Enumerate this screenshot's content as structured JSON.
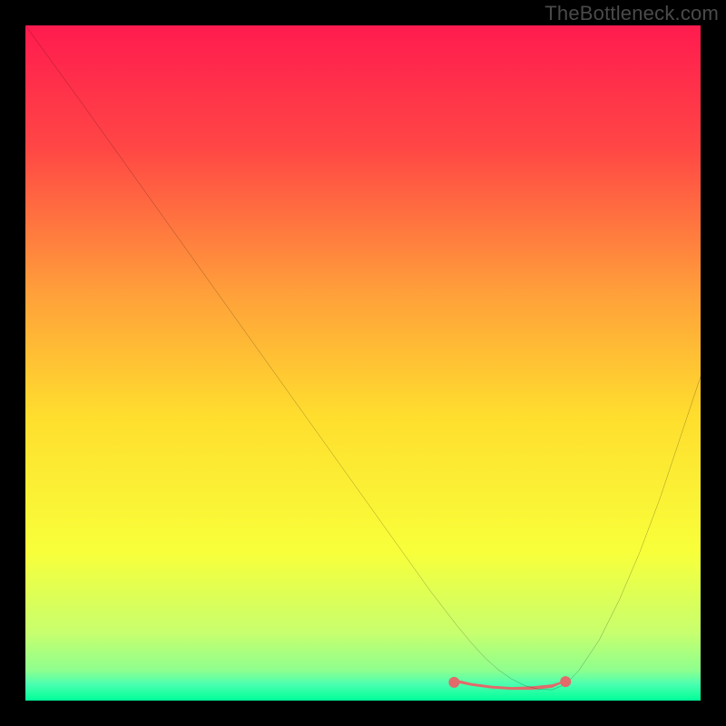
{
  "watermark": "TheBottleneck.com",
  "chart_data": {
    "type": "line",
    "title": "",
    "xlabel": "",
    "ylabel": "",
    "xlim": [
      0,
      100
    ],
    "ylim": [
      0,
      100
    ],
    "grid": false,
    "legend": false,
    "background_gradient_stops": [
      {
        "offset": 0.0,
        "color": "#ff1b4f"
      },
      {
        "offset": 0.18,
        "color": "#ff4645"
      },
      {
        "offset": 0.4,
        "color": "#ffa13a"
      },
      {
        "offset": 0.58,
        "color": "#ffde2e"
      },
      {
        "offset": 0.78,
        "color": "#f8ff3a"
      },
      {
        "offset": 0.9,
        "color": "#c7ff6e"
      },
      {
        "offset": 0.955,
        "color": "#8eff8e"
      },
      {
        "offset": 0.975,
        "color": "#4dffb0"
      },
      {
        "offset": 1.0,
        "color": "#00ff99"
      }
    ],
    "series": [
      {
        "name": "bottleneck-curve",
        "color": "#000000",
        "width": 1.4,
        "x": [
          0,
          4,
          8,
          12,
          16,
          20,
          24,
          28,
          32,
          36,
          40,
          44,
          48,
          52,
          56,
          60,
          62,
          64,
          66,
          68,
          70,
          72,
          74,
          76,
          78,
          80,
          82,
          85,
          88,
          91,
          94,
          97,
          100
        ],
        "y": [
          100,
          94.5,
          89,
          83.4,
          77.8,
          72.2,
          66.6,
          61,
          55.4,
          49.8,
          44.2,
          38.6,
          33,
          27.4,
          21.8,
          16.2,
          13.6,
          11,
          8.6,
          6.4,
          4.6,
          3.2,
          2.2,
          1.7,
          1.6,
          2.4,
          4.5,
          9,
          15,
          22,
          30,
          39,
          48
        ]
      }
    ],
    "markers": [
      {
        "name": "optimal-zone-left-end",
        "shape": "dot",
        "color": "#e26a6a",
        "r": 6,
        "x": 63.5,
        "y": 2.7
      },
      {
        "name": "optimal-zone-right-end",
        "shape": "dot",
        "color": "#e26a6a",
        "r": 6,
        "x": 80.0,
        "y": 2.8
      }
    ],
    "blob": {
      "name": "optimal-zone-band",
      "color": "#e26a6a",
      "points_top": [
        [
          63.5,
          2.7
        ],
        [
          66,
          2.2
        ],
        [
          69,
          1.8
        ],
        [
          72,
          1.6
        ],
        [
          75,
          1.6
        ],
        [
          78,
          1.9
        ],
        [
          80,
          2.8
        ]
      ],
      "points_bottom": [
        [
          80,
          3.0
        ],
        [
          78,
          2.4
        ],
        [
          75,
          2.1
        ],
        [
          72,
          2.0
        ],
        [
          69,
          2.2
        ],
        [
          66,
          2.6
        ],
        [
          63.5,
          3.2
        ]
      ]
    }
  }
}
